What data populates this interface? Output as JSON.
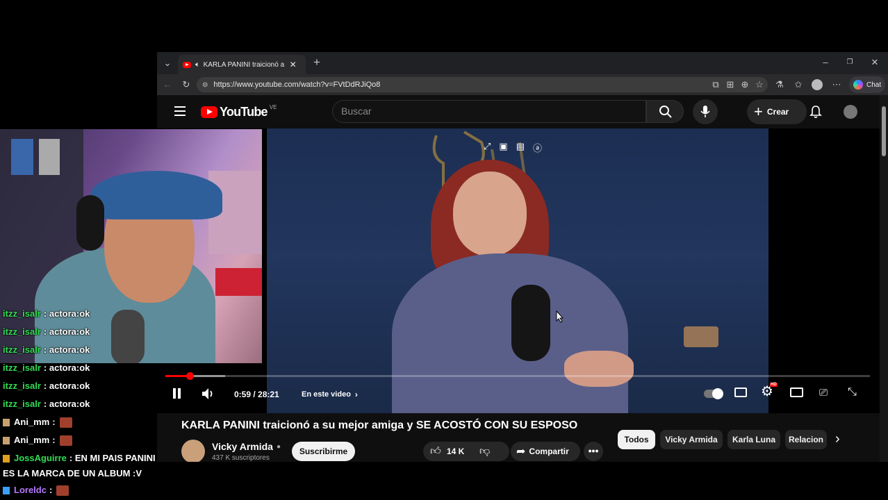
{
  "browser": {
    "tab_title": "KARLA PANINI traicionó a su...",
    "url": "https://www.youtube.com/watch?v=FVtDdRJiQo8",
    "copilot_label": "Chat"
  },
  "youtube": {
    "logo_text": "YouTube",
    "country_code": "VE",
    "search_placeholder": "Buscar",
    "create_label": "Crear"
  },
  "player": {
    "time_display": "0:59 / 28:21",
    "chapters_label": "En este video",
    "progress_fraction": 0.035,
    "buffer_fraction": 0.085,
    "settings_badge": "HD"
  },
  "video_info": {
    "title": "KARLA PANINI traicionó a su mejor amiga y SE ACOSTÓ CON SU ESPOSO",
    "channel_name": "Vicky Armida",
    "subscribers": "437 K suscriptores",
    "subscribe_label": "Suscribirme",
    "likes": "14 K",
    "share_label": "Compartir"
  },
  "chips": [
    "Todos",
    "Vicky Armida",
    "Karla Luna",
    "Relacion"
  ],
  "chat": [
    {
      "user": "itzz_isalr",
      "text": ": actora:ok",
      "color": "#33dd55",
      "emote": false
    },
    {
      "user": "itzz_isalr",
      "text": ": actora:ok",
      "color": "#33dd55",
      "emote": false
    },
    {
      "user": "itzz_isalr",
      "text": ": actora:ok",
      "color": "#33dd55",
      "emote": false
    },
    {
      "user": "itzz_isalr",
      "text": ": actora:ok",
      "color": "#33dd55",
      "emote": false
    },
    {
      "user": "itzz_isalr",
      "text": ": actora:ok",
      "color": "#33dd55",
      "emote": false
    },
    {
      "user": "itzz_isalr",
      "text": ": actora:ok",
      "color": "#33dd55",
      "emote": false
    },
    {
      "user": "Ani_mm",
      "text": ":",
      "color": "#ffffff",
      "emote": true
    },
    {
      "user": "Ani_mm",
      "text": ":",
      "color": "#ffffff",
      "emote": true
    },
    {
      "user": "JossAguirre",
      "text": ": EN MI PAIS PANINI",
      "color": "#33dd55",
      "emote": false
    },
    {
      "user": "",
      "text": "ES LA MARCA DE UN ALBUM :V",
      "color": "#ffffff",
      "emote": false
    },
    {
      "user": "Loreldc",
      "text": ":",
      "color": "#b678ff",
      "emote": true
    }
  ],
  "colors": {
    "youtube_red": "#ff0000",
    "background": "#0f0f0f",
    "chat_green": "#33dd55",
    "chat_purple": "#b678ff"
  }
}
